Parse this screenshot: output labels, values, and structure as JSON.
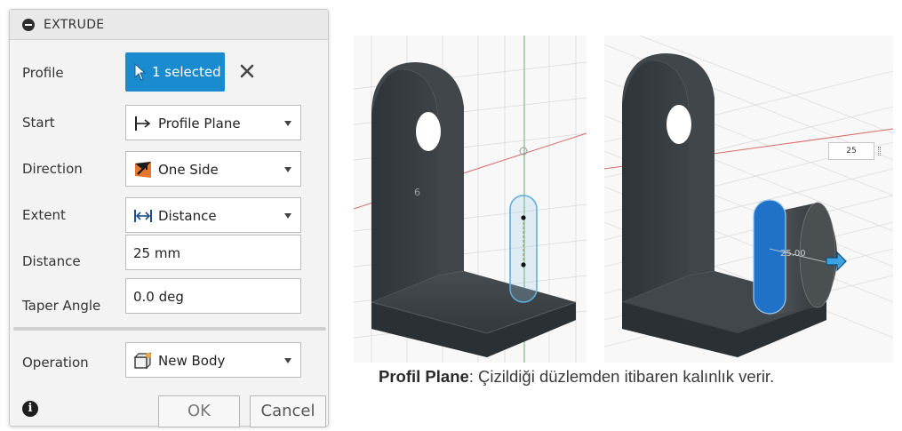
{
  "dialog": {
    "title": "EXTRUDE",
    "profile": {
      "label": "Profile",
      "value": "1 selected"
    },
    "start": {
      "label": "Start",
      "value": "Profile Plane"
    },
    "direction": {
      "label": "Direction",
      "value": "One Side"
    },
    "extent": {
      "label": "Extent",
      "value": "Distance"
    },
    "distance": {
      "label": "Distance",
      "value": "25 mm"
    },
    "taper_angle": {
      "label": "Taper Angle",
      "value": "0.0 deg"
    },
    "operation": {
      "label": "Operation",
      "value": "New Body"
    },
    "ok_label": "OK",
    "cancel_label": "Cancel",
    "info_glyph": "i",
    "accent_color": "#1b8bd0"
  },
  "viewport_left": {
    "dimension_text": "6"
  },
  "viewport_right": {
    "distance_box": "25",
    "dimension_text": "25.00"
  },
  "caption": {
    "bold": "Profil Plane",
    "text": ": Çizildiği düzlemden itibaren kalınlık verir."
  },
  "icons": [
    "collapse-icon",
    "cursor-icon",
    "clear-icon",
    "profile-plane-icon",
    "one-side-icon",
    "distance-icon",
    "new-body-icon",
    "info-icon",
    "move-arrow-icon"
  ]
}
